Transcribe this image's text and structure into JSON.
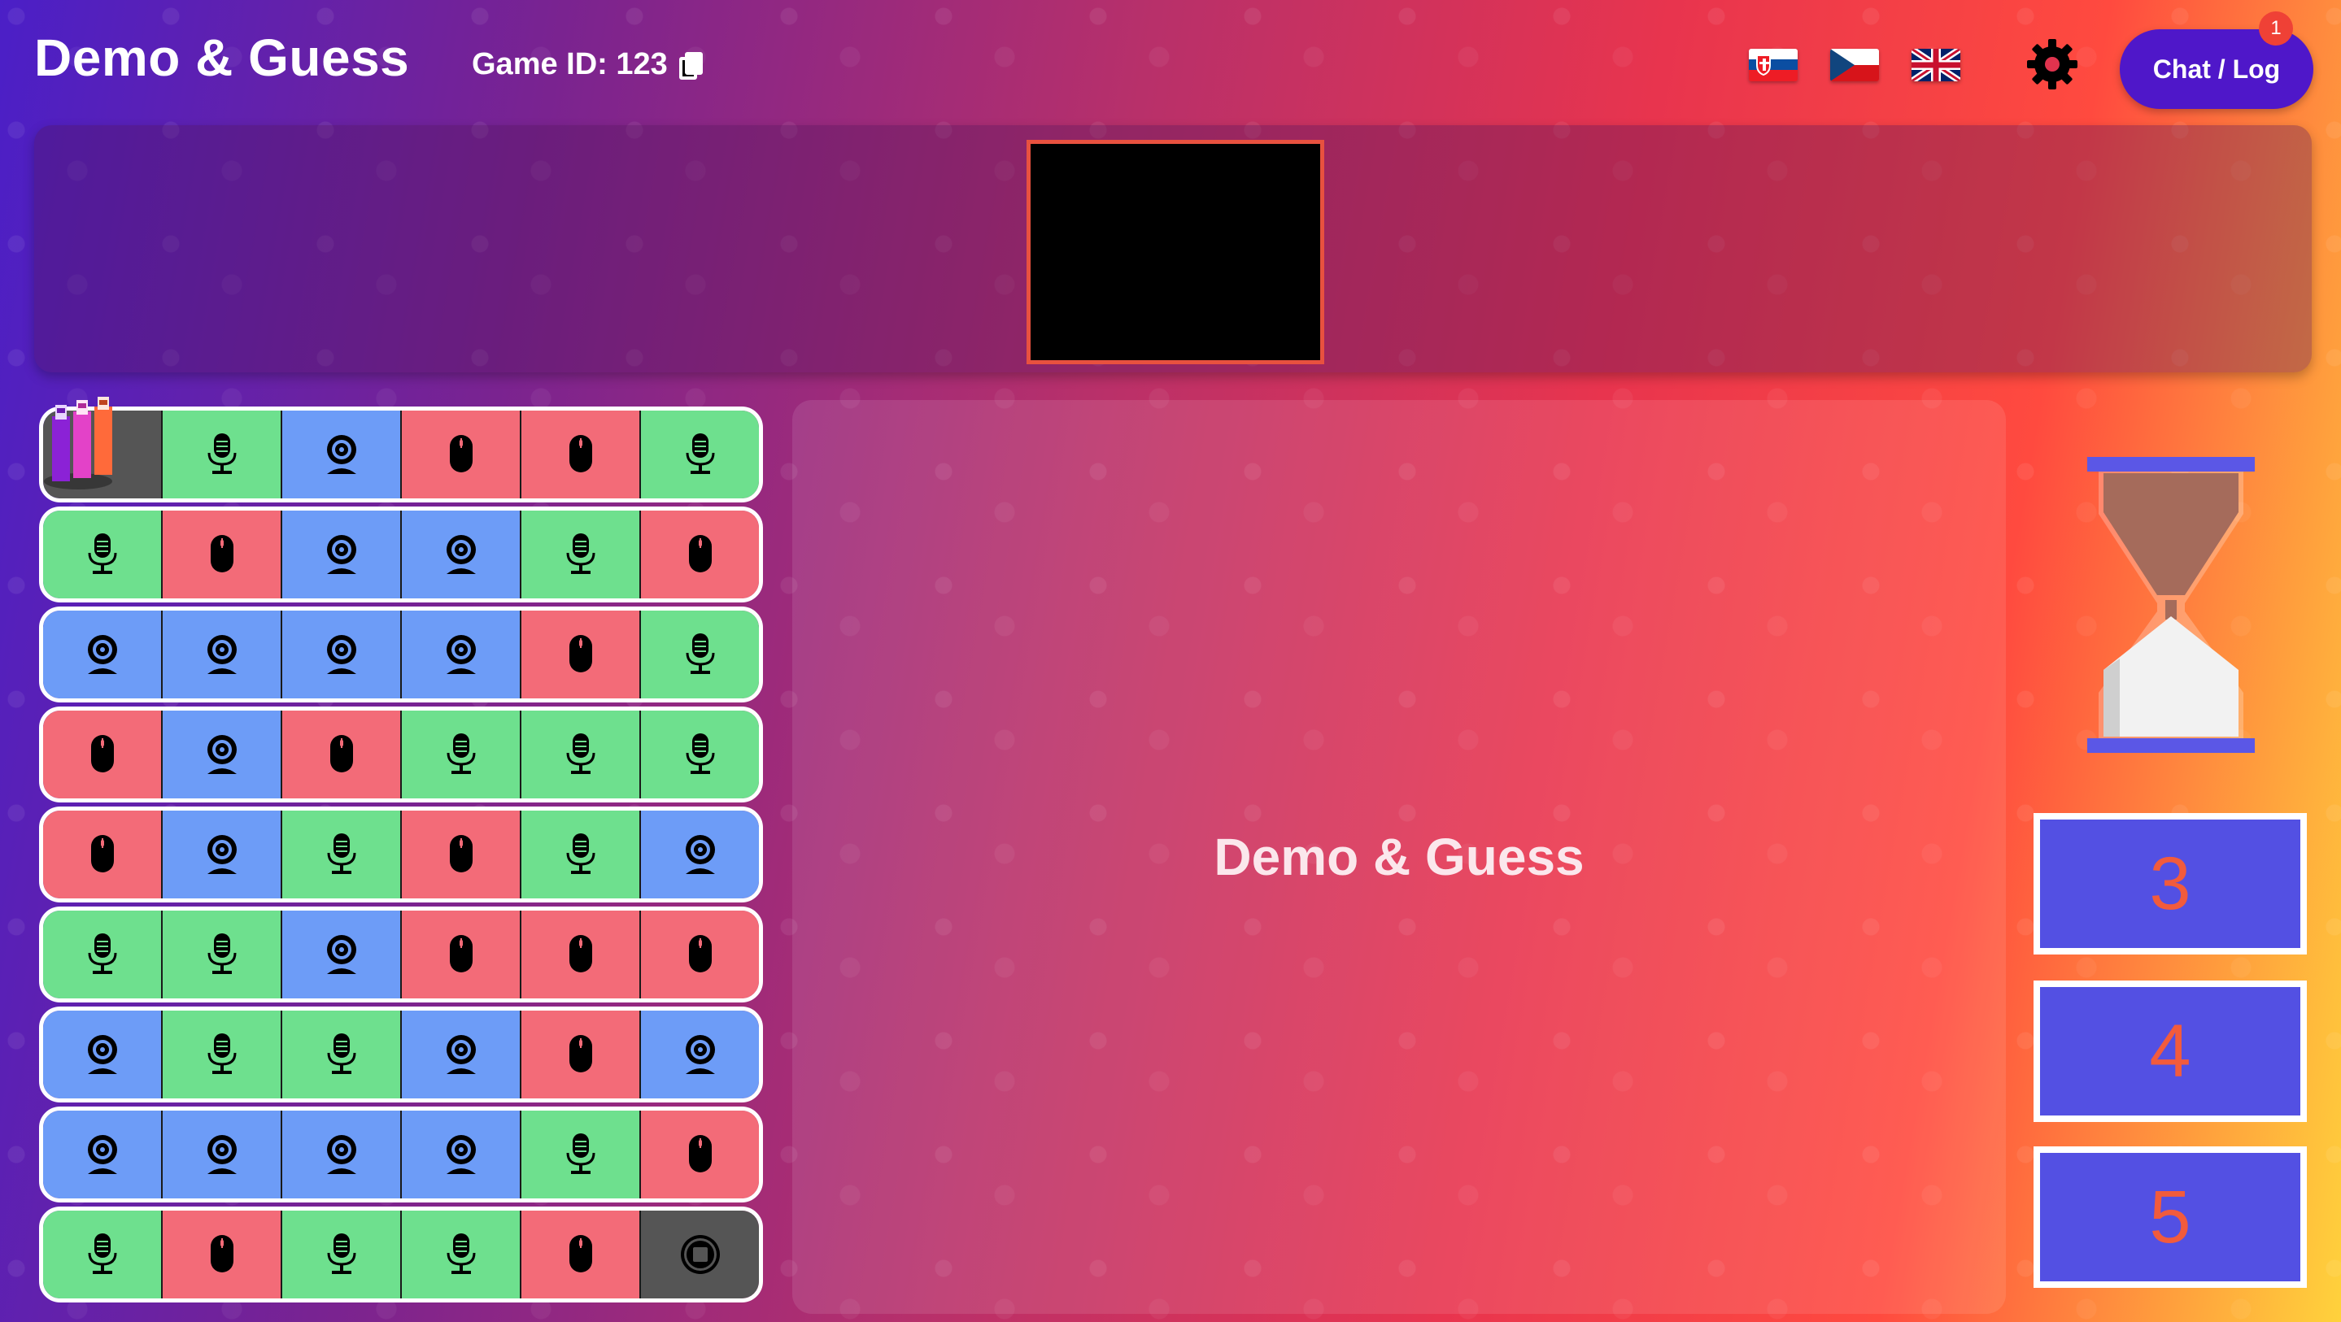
{
  "header": {
    "brand": "Demo & Guess",
    "game_id_label": "Game ID: 123",
    "copy_icon": "copy-icon",
    "languages": [
      "Slovak flag",
      "Czech flag",
      "UK flag"
    ],
    "settings_icon": "gear-icon",
    "chat_button_label": "Chat / Log",
    "chat_unread_count": "1"
  },
  "main": {
    "title": "Demo & Guess"
  },
  "board": {
    "rows": [
      [
        "start",
        "mic",
        "cam",
        "mouse",
        "mouse",
        "mic"
      ],
      [
        "mic",
        "mouse",
        "cam",
        "cam",
        "mic",
        "mouse"
      ],
      [
        "cam",
        "cam",
        "cam",
        "cam",
        "mouse",
        "mic"
      ],
      [
        "mouse",
        "cam",
        "mouse",
        "mic",
        "mic",
        "mic"
      ],
      [
        "mouse",
        "cam",
        "mic",
        "mouse",
        "mic",
        "cam"
      ],
      [
        "mic",
        "mic",
        "cam",
        "mouse",
        "mouse",
        "mouse"
      ],
      [
        "cam",
        "mic",
        "mic",
        "cam",
        "mouse",
        "cam"
      ],
      [
        "cam",
        "cam",
        "cam",
        "cam",
        "mic",
        "mouse"
      ],
      [
        "mic",
        "mouse",
        "mic",
        "mic",
        "mouse",
        "end"
      ]
    ],
    "pawn_colors": [
      "#a63cf0",
      "#e342c8",
      "#ff6a3a"
    ]
  },
  "cards": [
    "3",
    "4",
    "5"
  ],
  "colors": {
    "mic": "#6ee08e",
    "mouse": "#f36b78",
    "cam": "#6d9cf7",
    "card_bg": "#5350e3",
    "card_text": "#f25b3c",
    "chat_button": "#4f17c9"
  }
}
